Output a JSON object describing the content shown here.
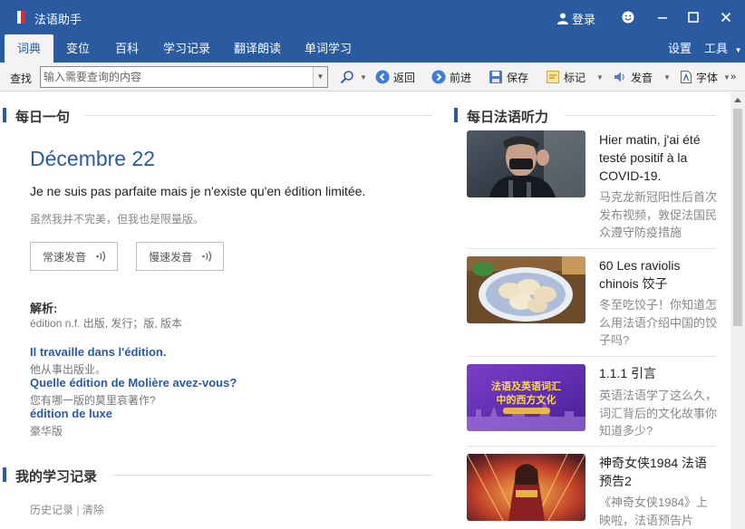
{
  "app": {
    "title": "法语助手",
    "login_label": "登录"
  },
  "colors": {
    "primary": "#2a5aa0",
    "link": "#2a5aa0"
  },
  "menu": {
    "tabs": [
      {
        "label": "词典",
        "active": true
      },
      {
        "label": "变位"
      },
      {
        "label": "百科"
      },
      {
        "label": "学习记录"
      },
      {
        "label": "翻译朗读"
      },
      {
        "label": "单词学习"
      }
    ],
    "settings_label": "设置",
    "tools_label": "工具"
  },
  "toolbar": {
    "search_label": "查找",
    "search_placeholder": "输入需要查询的内容",
    "back_label": "返回",
    "forward_label": "前进",
    "save_label": "保存",
    "mark_label": "标记",
    "pronounce_label": "发音",
    "font_label": "字体"
  },
  "daily_sentence": {
    "heading": "每日一句",
    "date": "Décembre 22",
    "french": "Je ne suis pas parfaite mais je n'existe qu'en édition limitée.",
    "chinese": "虽然我并不完美，但我也是限量版。",
    "normal_speed_label": "常速发音",
    "slow_speed_label": "慢速发音",
    "analysis_heading": "解析:",
    "analysis_text": "édition n.f. 出版, 发行；版, 版本",
    "examples": [
      {
        "fr": "Il travaille dans l'édition.",
        "cn": "他从事出版业。"
      },
      {
        "fr": "Quelle édition de Molière avez-vous?",
        "cn": "您有哪一版的莫里哀著作?"
      },
      {
        "fr": "édition de luxe",
        "cn": "豪华版"
      }
    ]
  },
  "study_record": {
    "heading": "我的学习记录",
    "history_label": "历史记录",
    "separator": "|",
    "clear_label": "清除"
  },
  "listening": {
    "heading": "每日法语听力",
    "items": [
      {
        "title": "Hier matin, j'ai été testé positif à la COVID-19.",
        "desc": "马克龙新冠阳性后首次发布视频，敦促法国民众遵守防疫措施",
        "thumb": "macron-photo"
      },
      {
        "title": "60 Les raviolis chinois 饺子",
        "desc": "冬至吃饺子！你知道怎么用法语介绍中国的饺子吗?",
        "thumb": "dumplings-photo"
      },
      {
        "title": "1.1.1 引言",
        "desc": "英语法语学了这么久，词汇背后的文化故事你知道多少?",
        "thumb": "course-banner",
        "thumb_text_1": "法语及英语词汇",
        "thumb_text_2": "中的西方文化"
      },
      {
        "title": "神奇女侠1984 法语预告2",
        "desc": "《神奇女侠1984》上映啦，法语预告片",
        "thumb": "wonder-woman-poster"
      }
    ]
  }
}
